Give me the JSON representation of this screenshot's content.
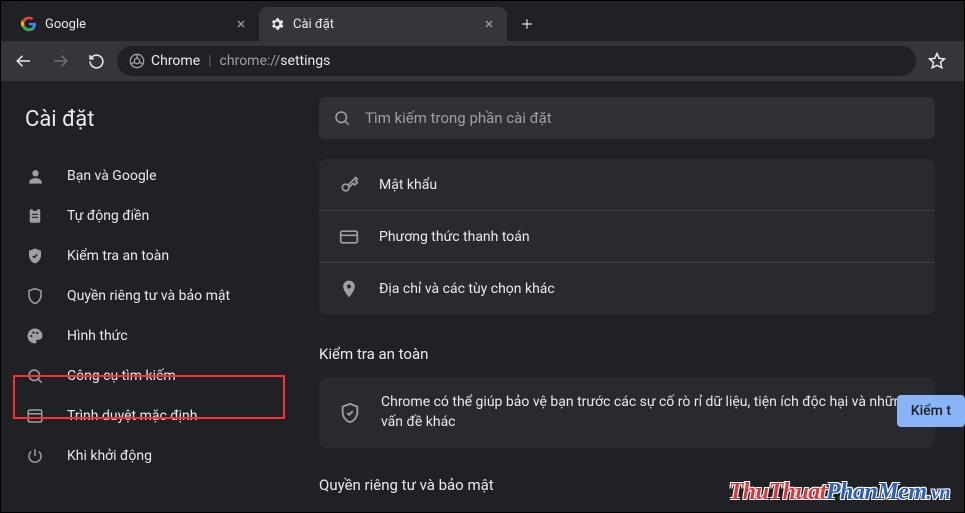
{
  "tabs": [
    {
      "title": "Google",
      "icon": "google"
    },
    {
      "title": "Cài đặt",
      "icon": "gear"
    }
  ],
  "omnibox": {
    "chip_label": "Chrome",
    "url_prefix": "chrome://",
    "url_main": "settings"
  },
  "settings_title": "Cài đặt",
  "search_placeholder": "Tìm kiếm trong phần cài đặt",
  "sidebar": {
    "items": [
      {
        "label": "Bạn và Google",
        "icon": "person"
      },
      {
        "label": "Tự động điền",
        "icon": "clipboard"
      },
      {
        "label": "Kiểm tra an toàn",
        "icon": "shield-check"
      },
      {
        "label": "Quyền riêng tư và bảo mật",
        "icon": "shield"
      },
      {
        "label": "Hình thức",
        "icon": "palette"
      },
      {
        "label": "Công cụ tìm kiếm",
        "icon": "search"
      },
      {
        "label": "Trình duyệt mặc định",
        "icon": "browser"
      },
      {
        "label": "Khi khởi động",
        "icon": "power"
      }
    ]
  },
  "autofill_card": {
    "rows": [
      {
        "label": "Mật khẩu",
        "icon": "key"
      },
      {
        "label": "Phương thức thanh toán",
        "icon": "card"
      },
      {
        "label": "Địa chỉ và các tùy chọn khác",
        "icon": "pin"
      }
    ]
  },
  "sections": {
    "safety_heading": "Kiểm tra an toàn",
    "safety_text": "Chrome có thể giúp bảo vệ bạn trước các sự cố rò rỉ dữ liệu, tiện ích độc hại và những vấn đề khác",
    "safety_button": "Kiểm t",
    "privacy_heading": "Quyền riêng tư và bảo mật"
  },
  "watermark": {
    "part1": "ThuThuat",
    "part2": "PhanMem",
    "part3": ".vn"
  },
  "colors": {
    "bg": "#202124",
    "surface": "#292a2d",
    "toolbar": "#35363a",
    "accent": "#8ab4f8",
    "highlight": "#ff2e2e"
  }
}
